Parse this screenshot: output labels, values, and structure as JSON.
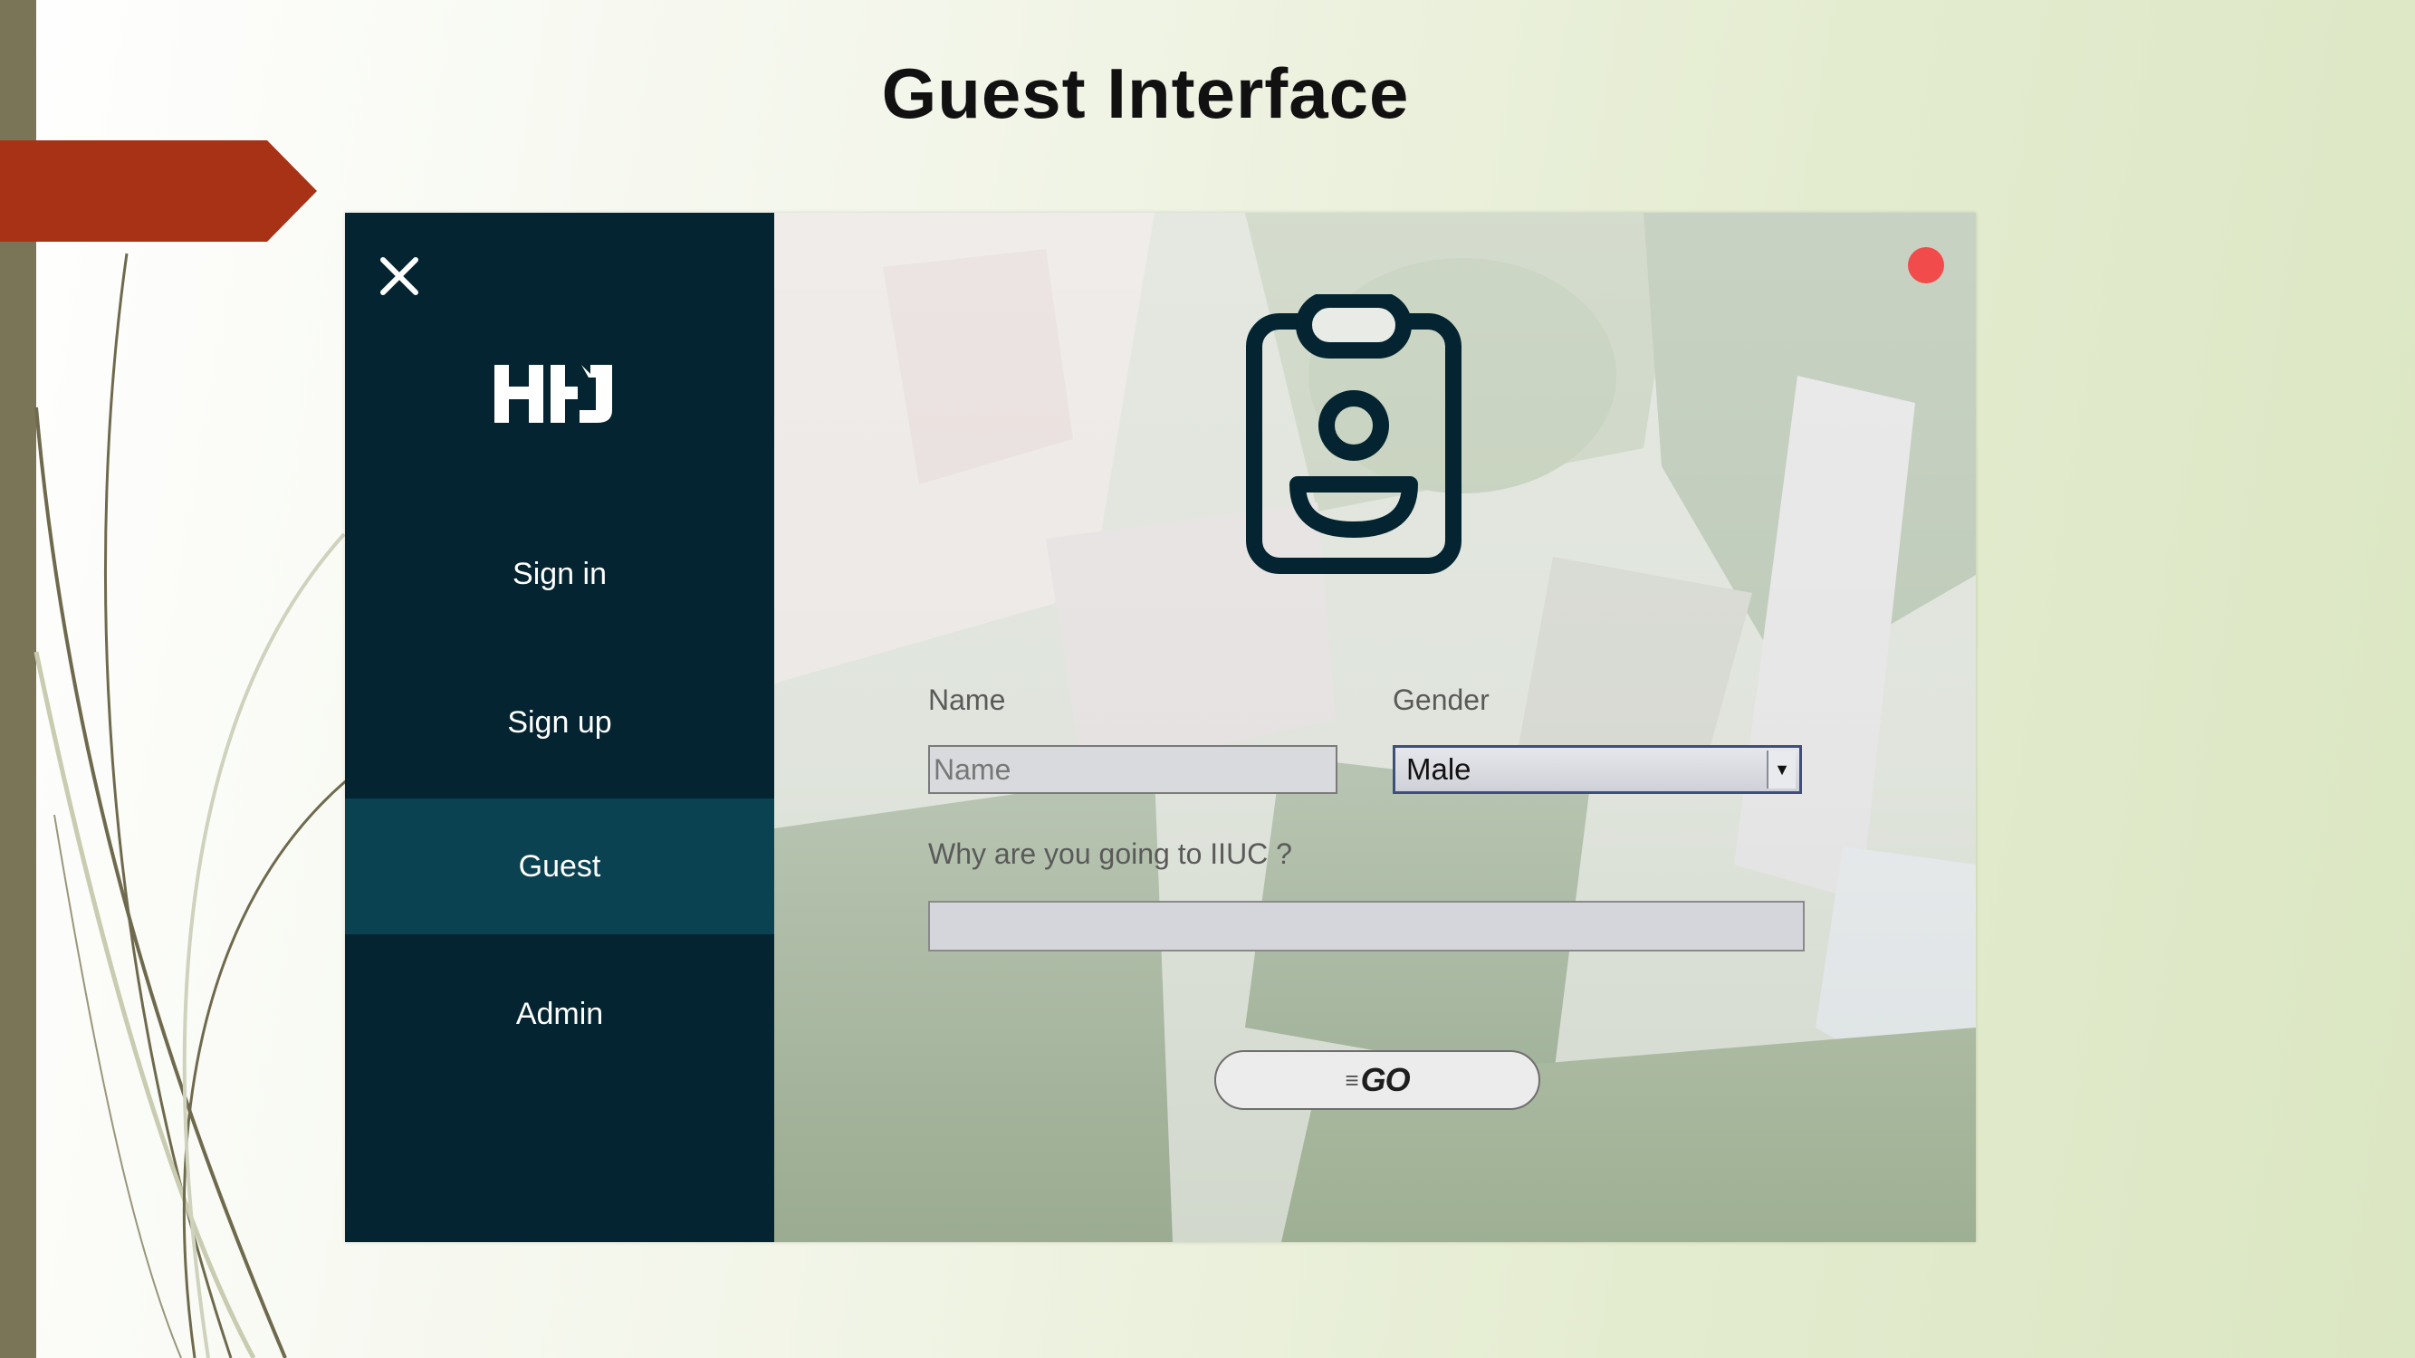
{
  "slide": {
    "title": "Guest Interface"
  },
  "sidebar": {
    "logo_text": "HHJ",
    "items": [
      {
        "label": "Sign in",
        "active": false
      },
      {
        "label": "Sign up",
        "active": false
      },
      {
        "label": "Guest",
        "active": true
      },
      {
        "label": "Admin",
        "active": false
      }
    ]
  },
  "form": {
    "name_label": "Name",
    "name_placeholder": "Name",
    "gender_label": "Gender",
    "gender_value": "Male",
    "reason_label": "Why are you going to IIUC ?",
    "go_label": "GO"
  },
  "icons": {
    "close": "close-icon",
    "badge": "id-badge-icon",
    "dropdown": "chevron-down-icon"
  },
  "colors": {
    "sidebar_bg": "#032430",
    "sidebar_active": "#0b4252",
    "status_dot": "#f24b4b",
    "accent_arrow": "#a83216"
  }
}
